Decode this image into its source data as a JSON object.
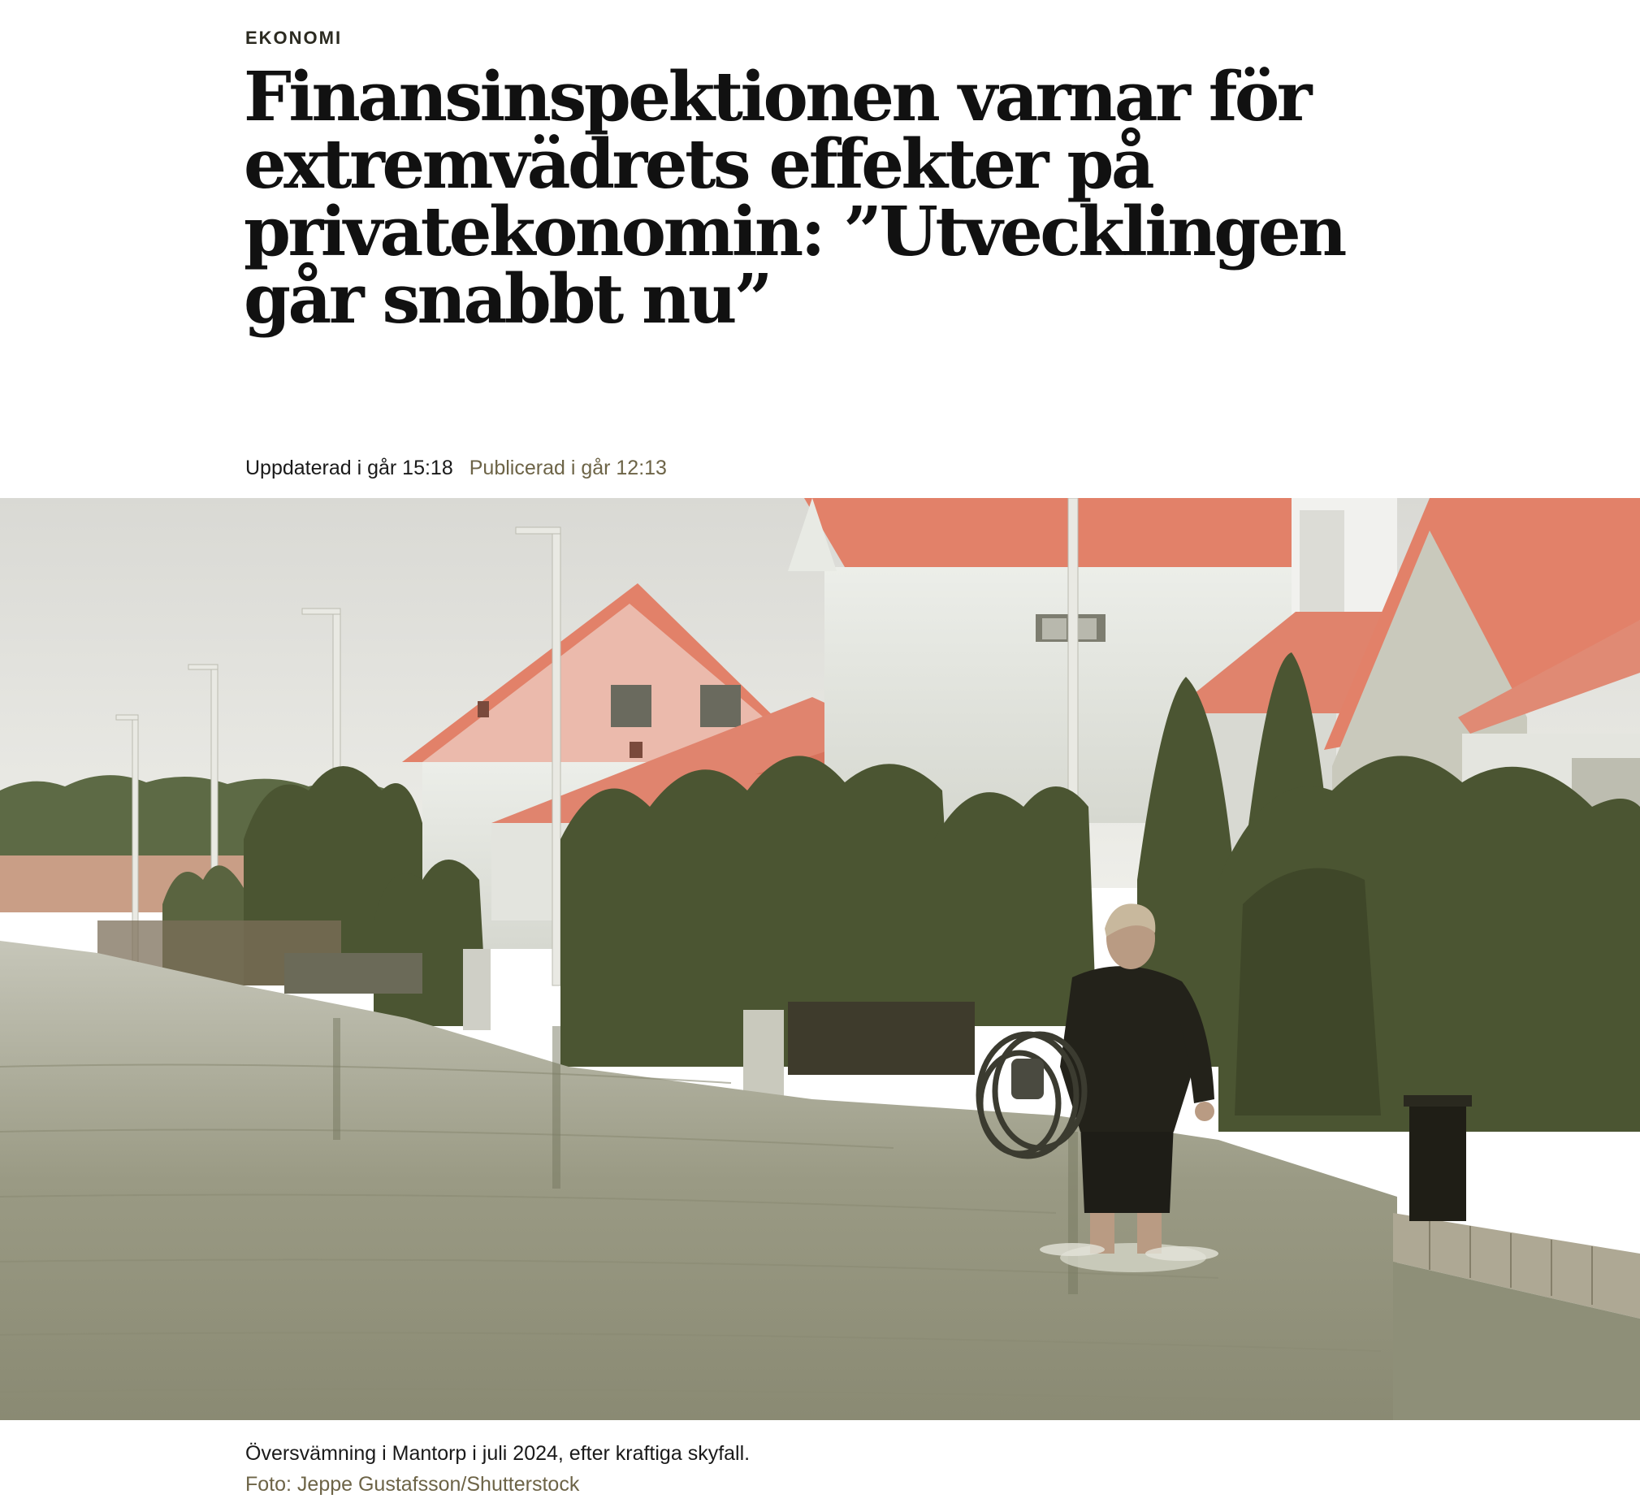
{
  "article": {
    "section": "EKONOMI",
    "headline": "Finansinspektionen varnar för extremvädrets effekter på privatekonomin: ”Utvecklingen går snabbt nu”",
    "updated": "Uppdaterad i går 15:18",
    "published": "Publicerad i går 12:13",
    "image": {
      "caption": "Översvämning i Mantorp i juli 2024, efter kraftiga skyfall.",
      "credit": "Foto: Jeppe Gustafsson/Shutterstock"
    }
  },
  "colors": {
    "text": "#111111",
    "muted": "#6d6447",
    "background": "#ffffff",
    "roof": "#e0806a",
    "vegetation": "#4a5330",
    "water": "#a9aa95"
  }
}
